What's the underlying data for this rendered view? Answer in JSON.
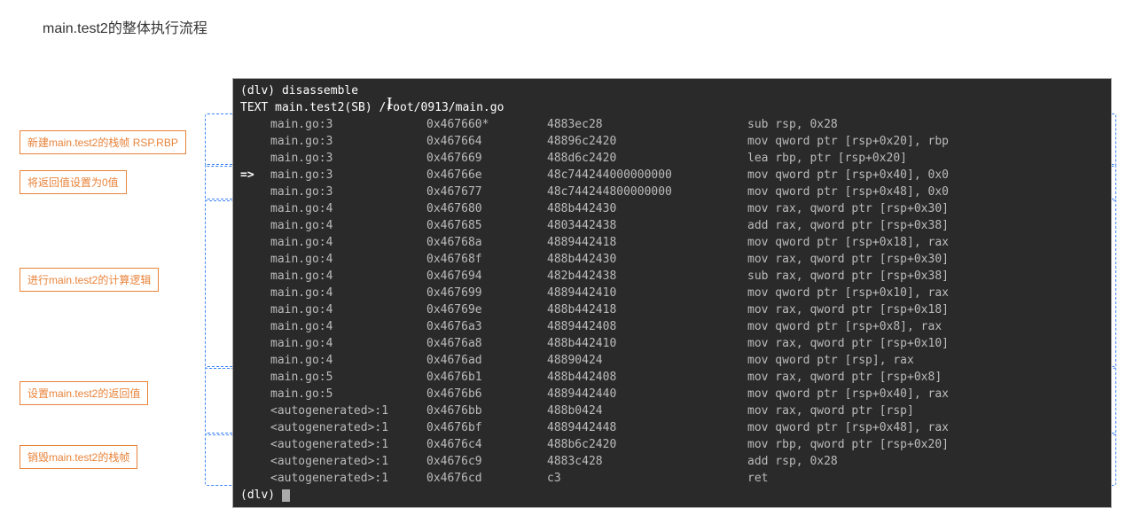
{
  "title": "main.test2的整体执行流程",
  "annotations": {
    "a1": "新建main.test2的栈帧 RSP.RBP",
    "a2": "将返回值设置为0值",
    "a3": "进行main.test2的计算逻辑",
    "a4": "设置main.test2的返回值",
    "a5": "销毁main.test2的栈帧"
  },
  "terminal": {
    "prompt1": "(dlv) disassemble",
    "header": "TEXT main.test2(SB) /root/0913/main.go",
    "prompt2": "(dlv) ",
    "rows": [
      {
        "arrow": "",
        "src": "main.go:3",
        "addr": "0x467660*",
        "hex": "4883ec28",
        "asm": "sub rsp, 0x28"
      },
      {
        "arrow": "",
        "src": "main.go:3",
        "addr": "0x467664",
        "hex": "48896c2420",
        "asm": "mov qword ptr [rsp+0x20], rbp"
      },
      {
        "arrow": "",
        "src": "main.go:3",
        "addr": "0x467669",
        "hex": "488d6c2420",
        "asm": "lea rbp, ptr [rsp+0x20]"
      },
      {
        "arrow": "=>",
        "src": "main.go:3",
        "addr": "0x46766e",
        "hex": "48c744244000000000",
        "asm": "mov qword ptr [rsp+0x40], 0x0"
      },
      {
        "arrow": "",
        "src": "main.go:3",
        "addr": "0x467677",
        "hex": "48c744244800000000",
        "asm": "mov qword ptr [rsp+0x48], 0x0"
      },
      {
        "arrow": "",
        "src": "main.go:4",
        "addr": "0x467680",
        "hex": "488b442430",
        "asm": "mov rax, qword ptr [rsp+0x30]"
      },
      {
        "arrow": "",
        "src": "main.go:4",
        "addr": "0x467685",
        "hex": "4803442438",
        "asm": "add rax, qword ptr [rsp+0x38]"
      },
      {
        "arrow": "",
        "src": "main.go:4",
        "addr": "0x46768a",
        "hex": "4889442418",
        "asm": "mov qword ptr [rsp+0x18], rax"
      },
      {
        "arrow": "",
        "src": "main.go:4",
        "addr": "0x46768f",
        "hex": "488b442430",
        "asm": "mov rax, qword ptr [rsp+0x30]"
      },
      {
        "arrow": "",
        "src": "main.go:4",
        "addr": "0x467694",
        "hex": "482b442438",
        "asm": "sub rax, qword ptr [rsp+0x38]"
      },
      {
        "arrow": "",
        "src": "main.go:4",
        "addr": "0x467699",
        "hex": "4889442410",
        "asm": "mov qword ptr [rsp+0x10], rax"
      },
      {
        "arrow": "",
        "src": "main.go:4",
        "addr": "0x46769e",
        "hex": "488b442418",
        "asm": "mov rax, qword ptr [rsp+0x18]"
      },
      {
        "arrow": "",
        "src": "main.go:4",
        "addr": "0x4676a3",
        "hex": "4889442408",
        "asm": "mov qword ptr [rsp+0x8], rax"
      },
      {
        "arrow": "",
        "src": "main.go:4",
        "addr": "0x4676a8",
        "hex": "488b442410",
        "asm": "mov rax, qword ptr [rsp+0x10]"
      },
      {
        "arrow": "",
        "src": "main.go:4",
        "addr": "0x4676ad",
        "hex": "48890424",
        "asm": "mov qword ptr [rsp], rax"
      },
      {
        "arrow": "",
        "src": "main.go:5",
        "addr": "0x4676b1",
        "hex": "488b442408",
        "asm": "mov rax, qword ptr [rsp+0x8]"
      },
      {
        "arrow": "",
        "src": "main.go:5",
        "addr": "0x4676b6",
        "hex": "4889442440",
        "asm": "mov qword ptr [rsp+0x40], rax"
      },
      {
        "arrow": "",
        "src": "<autogenerated>:1",
        "addr": "0x4676bb",
        "hex": "488b0424",
        "asm": "mov rax, qword ptr [rsp]"
      },
      {
        "arrow": "",
        "src": "<autogenerated>:1",
        "addr": "0x4676bf",
        "hex": "4889442448",
        "asm": "mov qword ptr [rsp+0x48], rax"
      },
      {
        "arrow": "",
        "src": "<autogenerated>:1",
        "addr": "0x4676c4",
        "hex": "488b6c2420",
        "asm": "mov rbp, qword ptr [rsp+0x20]"
      },
      {
        "arrow": "",
        "src": "<autogenerated>:1",
        "addr": "0x4676c9",
        "hex": "4883c428",
        "asm": "add rsp, 0x28"
      },
      {
        "arrow": "",
        "src": "<autogenerated>:1",
        "addr": "0x4676cd",
        "hex": "c3",
        "asm": "ret"
      }
    ]
  }
}
